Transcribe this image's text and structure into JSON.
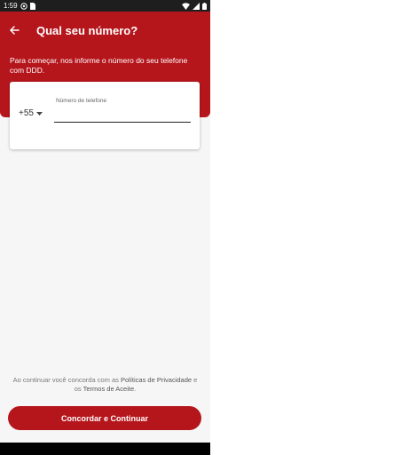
{
  "status_bar": {
    "time": "1:59"
  },
  "header": {
    "title": "Qual seu número?",
    "subtitle": "Para começar, nos informe o número do seu telefone com DDD."
  },
  "form": {
    "country_code": "+55",
    "phone_label": "Número de telefone"
  },
  "terms": {
    "prefix": "Ao continuar você concorda com as ",
    "privacy": "Políticas de Privacidade",
    "middle": " e os ",
    "acceptance": "Termos de Aceite",
    "suffix": "."
  },
  "actions": {
    "continue_label": "Concordar e Continuar"
  },
  "colors": {
    "brand": "#b5161c",
    "background": "#f6f6f6"
  }
}
